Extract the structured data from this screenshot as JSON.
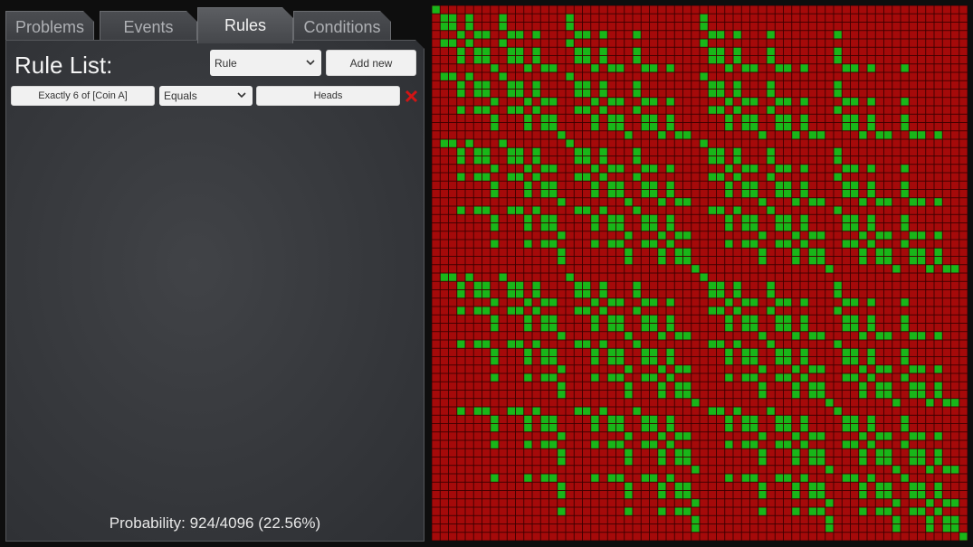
{
  "tabs": [
    {
      "label": "Problems",
      "active": false
    },
    {
      "label": "Events",
      "active": false
    },
    {
      "label": "Rules",
      "active": true
    },
    {
      "label": "Conditions",
      "active": false
    }
  ],
  "panel": {
    "title": "Rule List:",
    "type_select": {
      "value": "Rule"
    },
    "add_button": "Add new",
    "rules": [
      {
        "subject": "Exactly 6 of [Coin A]",
        "operator": "Equals",
        "value": "Heads"
      }
    ],
    "probability": "Probability: 924/4096 (22.56%)"
  },
  "grid": {
    "total_outcomes": 4096,
    "favorable_outcomes": 924,
    "coins": 12,
    "rule_popcount": 6,
    "colors": {
      "match": "#19b619",
      "nomatch": "#a50a0a",
      "border": "#3a0000"
    }
  },
  "colors": {
    "delete_icon": "#d11515"
  }
}
